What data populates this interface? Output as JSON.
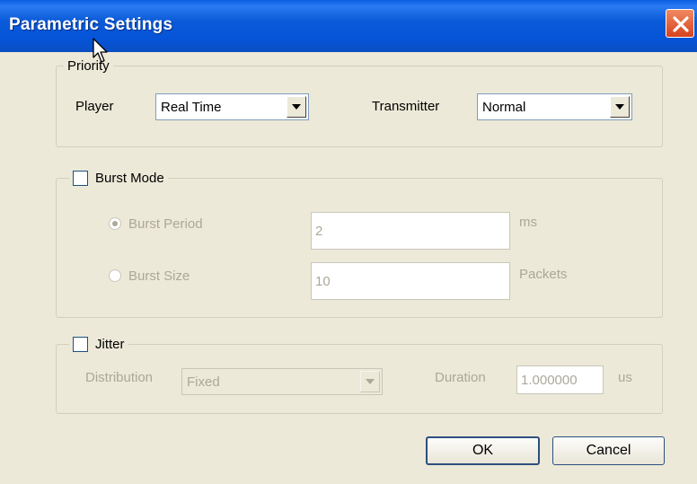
{
  "window": {
    "title": "Parametric Settings"
  },
  "priority": {
    "legend": "Priority",
    "player_label": "Player",
    "player_value": "Real Time",
    "transmitter_label": "Transmitter",
    "transmitter_value": "Normal"
  },
  "burst": {
    "legend": "Burst Mode",
    "checked": false,
    "period_label": "Burst Period",
    "period_value": "2",
    "period_unit": "ms",
    "size_label": "Burst Size",
    "size_value": "10",
    "size_unit": "Packets",
    "selected_option": "Burst Period"
  },
  "jitter": {
    "legend": "Jitter",
    "checked": false,
    "distribution_label": "Distribution",
    "distribution_value": "Fixed",
    "duration_label": "Duration",
    "duration_value": "1.000000",
    "duration_unit": "us"
  },
  "buttons": {
    "ok": "OK",
    "cancel": "Cancel"
  },
  "colors": {
    "titlebar": "#0554d8",
    "close": "#d8421e",
    "face": "#ece9d8",
    "disabled_text": "#aca899"
  },
  "icons": {
    "close": "close-icon",
    "dropdown": "chevron-down-icon",
    "cursor": "mouse-pointer-icon"
  }
}
